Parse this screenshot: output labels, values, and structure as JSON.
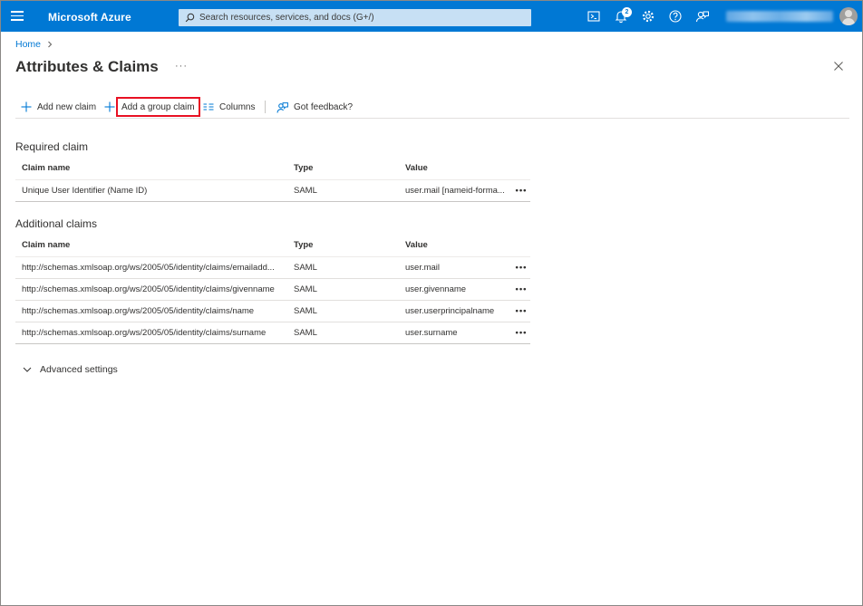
{
  "topbar": {
    "brand": "Microsoft Azure",
    "search_placeholder": "Search resources, services, and docs (G+/)",
    "notification_count": "2",
    "icons": [
      "menu-icon",
      "search-icon",
      "cloud-shell-icon",
      "notifications-icon",
      "settings-icon",
      "help-icon",
      "feedback-icon"
    ]
  },
  "breadcrumb": {
    "home": "Home"
  },
  "page": {
    "title": "Attributes & Claims",
    "more": "···"
  },
  "toolbar": {
    "add_new_claim": "Add new claim",
    "add_group_claim": "Add a group claim",
    "columns": "Columns",
    "got_feedback": "Got feedback?"
  },
  "required": {
    "title": "Required claim",
    "headers": {
      "name": "Claim name",
      "type": "Type",
      "value": "Value"
    },
    "rows": [
      {
        "name": "Unique User Identifier (Name ID)",
        "type": "SAML",
        "value": "user.mail [nameid-forma..."
      }
    ]
  },
  "additional": {
    "title": "Additional claims",
    "headers": {
      "name": "Claim name",
      "type": "Type",
      "value": "Value"
    },
    "rows": [
      {
        "name": "http://schemas.xmlsoap.org/ws/2005/05/identity/claims/emailadd...",
        "type": "SAML",
        "value": "user.mail"
      },
      {
        "name": "http://schemas.xmlsoap.org/ws/2005/05/identity/claims/givenname",
        "type": "SAML",
        "value": "user.givenname"
      },
      {
        "name": "http://schemas.xmlsoap.org/ws/2005/05/identity/claims/name",
        "type": "SAML",
        "value": "user.userprincipalname"
      },
      {
        "name": "http://schemas.xmlsoap.org/ws/2005/05/identity/claims/surname",
        "type": "SAML",
        "value": "user.surname"
      }
    ]
  },
  "advanced": {
    "label": "Advanced settings"
  },
  "row_more": "•••",
  "colors": {
    "accent": "#0078d4",
    "highlight": "#e81123",
    "search_bg": "#c7e0f4"
  }
}
